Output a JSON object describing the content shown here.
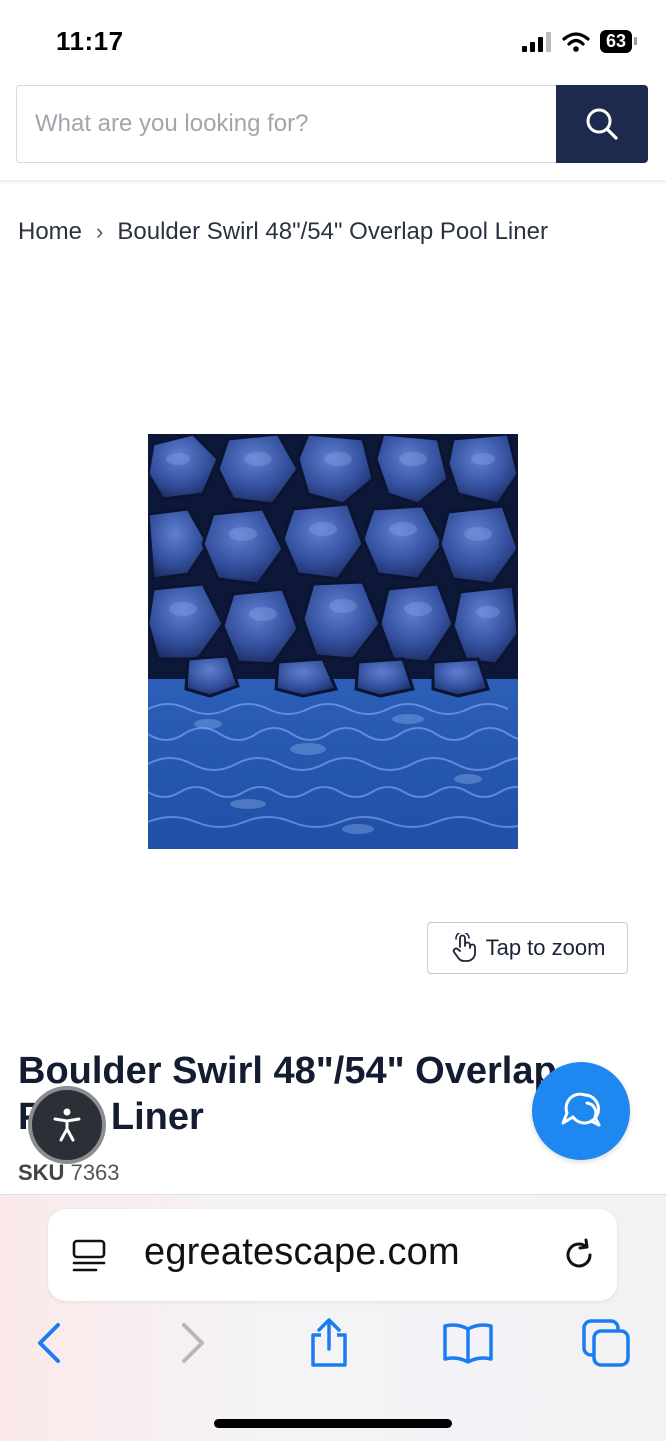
{
  "status": {
    "time": "11:17",
    "battery": "63",
    "signal_icon": "cellular-signal-icon",
    "wifi_icon": "wifi-icon"
  },
  "search": {
    "placeholder": "What are you looking for?",
    "button_icon": "search-icon"
  },
  "breadcrumb": {
    "home": "Home",
    "separator": "›",
    "current": "Boulder Swirl 48\"/54\" Overlap Pool Liner"
  },
  "product": {
    "image_alt": "Boulder Swirl pool liner pattern",
    "zoom_label": "Tap to zoom",
    "title": "Boulder Swirl 48\"/54\" Overlap Pool Liner",
    "sku_label": "SKU",
    "sku_value": "7363"
  },
  "floating": {
    "accessibility_icon": "accessibility-icon",
    "chat_icon": "chat-icon"
  },
  "browser": {
    "url": "egreatescape.com",
    "toolbar": [
      "back",
      "forward",
      "share",
      "bookmarks",
      "tabs"
    ]
  },
  "colors": {
    "search_button": "#1d2a4d",
    "chat_button": "#1e88f0",
    "ios_blue": "#1a7cf2"
  }
}
